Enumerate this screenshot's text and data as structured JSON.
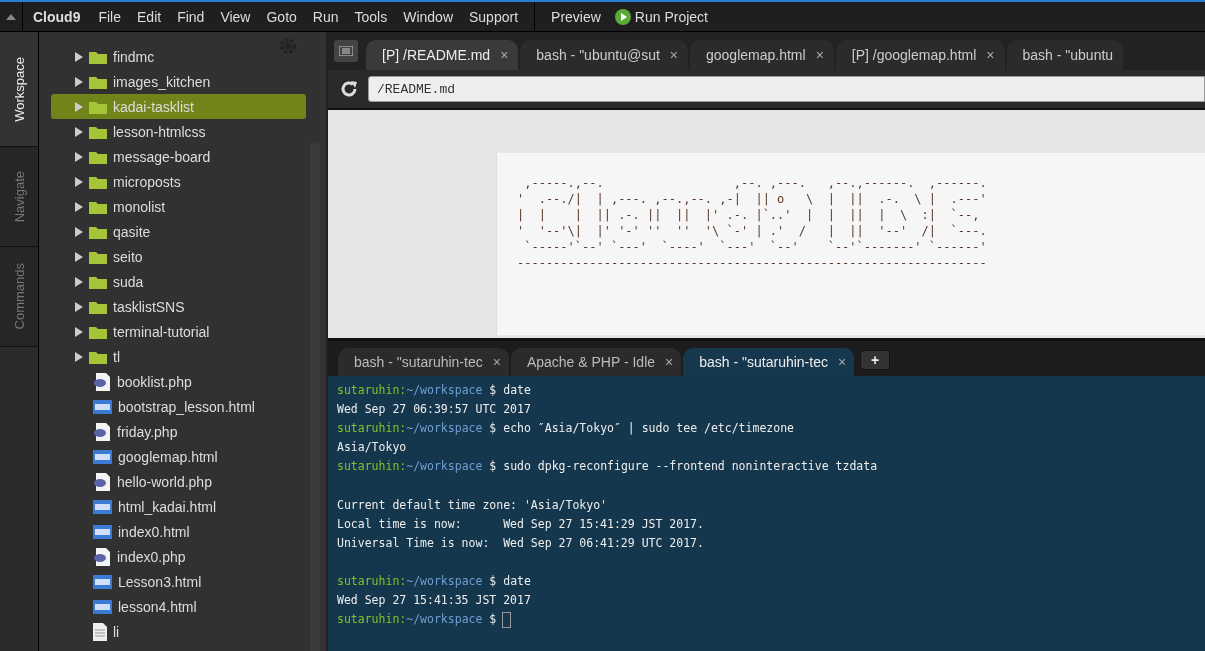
{
  "menubar": {
    "brand": "Cloud9",
    "items": [
      "File",
      "Edit",
      "Find",
      "View",
      "Goto",
      "Run",
      "Tools",
      "Window",
      "Support"
    ],
    "preview": "Preview",
    "run": "Run Project"
  },
  "side_tabs": [
    {
      "label": "Workspace",
      "selected": true
    },
    {
      "label": "Navigate",
      "selected": false
    },
    {
      "label": "Commands",
      "selected": false
    }
  ],
  "tree": [
    {
      "kind": "folder",
      "name": "findmc",
      "selected": false
    },
    {
      "kind": "folder",
      "name": "images_kitchen",
      "selected": false
    },
    {
      "kind": "folder",
      "name": "kadai-tasklist",
      "selected": true
    },
    {
      "kind": "folder",
      "name": "lesson-htmlcss",
      "selected": false
    },
    {
      "kind": "folder",
      "name": "message-board",
      "selected": false
    },
    {
      "kind": "folder",
      "name": "microposts",
      "selected": false
    },
    {
      "kind": "folder",
      "name": "monolist",
      "selected": false
    },
    {
      "kind": "folder",
      "name": "qasite",
      "selected": false
    },
    {
      "kind": "folder",
      "name": "seito",
      "selected": false
    },
    {
      "kind": "folder",
      "name": "suda",
      "selected": false
    },
    {
      "kind": "folder",
      "name": "tasklistSNS",
      "selected": false
    },
    {
      "kind": "folder",
      "name": "terminal-tutorial",
      "selected": false
    },
    {
      "kind": "folder",
      "name": "tl",
      "selected": false
    },
    {
      "kind": "php",
      "name": "booklist.php",
      "selected": false
    },
    {
      "kind": "html",
      "name": "bootstrap_lesson.html",
      "selected": false
    },
    {
      "kind": "php",
      "name": "friday.php",
      "selected": false
    },
    {
      "kind": "html",
      "name": "googlemap.html",
      "selected": false
    },
    {
      "kind": "php",
      "name": "hello-world.php",
      "selected": false
    },
    {
      "kind": "html",
      "name": "html_kadai.html",
      "selected": false
    },
    {
      "kind": "html",
      "name": "index0.html",
      "selected": false
    },
    {
      "kind": "php",
      "name": "index0.php",
      "selected": false
    },
    {
      "kind": "html",
      "name": "Lesson3.html",
      "selected": false
    },
    {
      "kind": "html",
      "name": "lesson4.html",
      "selected": false
    },
    {
      "kind": "text",
      "name": "li",
      "selected": false
    }
  ],
  "editor_tabs": [
    {
      "label": "[P] /README.md",
      "close": "×",
      "selected": true
    },
    {
      "label": "bash - \"ubuntu@sut",
      "close": "×",
      "selected": false
    },
    {
      "label": "googlemap.html",
      "close": "×",
      "selected": false
    },
    {
      "label": "[P] /googlemap.html",
      "close": "×",
      "selected": false
    },
    {
      "label": "bash - \"ubuntu",
      "selected": false
    }
  ],
  "address": "/README.md",
  "readme_art": [
    " ,-----.,--.                  ,--. ,---.   ,--.,------.  ,------.",
    "'  .--./|  | ,---. ,--.,--. ,-|  || o   \\  |  ||  .-.  \\ |  .---'",
    "|  |    |  || .-. ||  ||  |' .-. |`..'  |  |  ||  |  \\  :|  `--,",
    "'  '--'\\|  |' '-' ''  ''  '\\ `-' | .'  /   |  ||  '--'  /|  `---.",
    " `-----'`--' `---'  `----'  `---'  `--'    `--'`-------' `------'",
    "-----------------------------------------------------------------"
  ],
  "terminal_tabs": [
    {
      "label": "bash - \"sutaruhin-tec",
      "close": "×",
      "selected": false
    },
    {
      "label": "Apache & PHP - Idle",
      "close": "×",
      "selected": false
    },
    {
      "label": "bash - \"sutaruhin-tec",
      "close": "×",
      "selected": true
    }
  ],
  "new_tab": "+",
  "terminal": [
    {
      "kind": "prompt",
      "user": "sutaruhin:",
      "path": "~/workspace",
      "command": "$ date"
    },
    {
      "kind": "output",
      "text": "Wed Sep 27 06:39:57 UTC 2017"
    },
    {
      "kind": "prompt",
      "user": "sutaruhin:",
      "path": "~/workspace",
      "command": "$ echo ″Asia/Tokyo″ | sudo tee /etc/timezone"
    },
    {
      "kind": "output",
      "text": "Asia/Tokyo"
    },
    {
      "kind": "prompt",
      "user": "sutaruhin:",
      "path": "~/workspace",
      "command": "$ sudo dpkg-reconfigure --frontend noninteractive tzdata"
    },
    {
      "kind": "blank"
    },
    {
      "kind": "output",
      "text": "Current default time zone: 'Asia/Tokyo'"
    },
    {
      "kind": "output",
      "text": "Local time is now:      Wed Sep 27 15:41:29 JST 2017."
    },
    {
      "kind": "output",
      "text": "Universal Time is now:  Wed Sep 27 06:41:29 UTC 2017."
    },
    {
      "kind": "blank"
    },
    {
      "kind": "prompt",
      "user": "sutaruhin:",
      "path": "~/workspace",
      "command": "$ date"
    },
    {
      "kind": "output",
      "text": "Wed Sep 27 15:41:35 JST 2017"
    },
    {
      "kind": "prompt",
      "user": "sutaruhin:",
      "path": "~/workspace",
      "command": "$",
      "cursor": true
    }
  ]
}
